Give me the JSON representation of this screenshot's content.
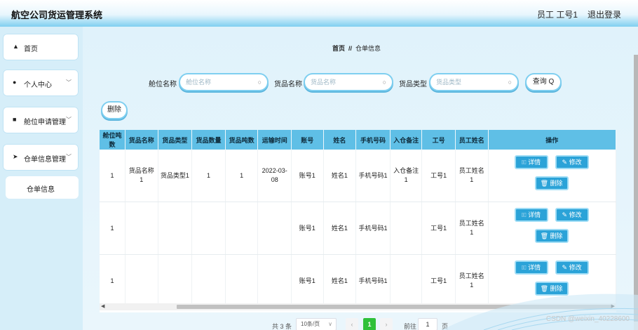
{
  "header": {
    "title": "航空公司货运管理系统",
    "user": "员工 工号1",
    "logout": "退出登录"
  },
  "sidebar": {
    "items": [
      {
        "label": "首页",
        "icon": "home-icon",
        "glyph": "▲"
      },
      {
        "label": "个人中心",
        "icon": "user-icon",
        "glyph": "●"
      },
      {
        "label": "舱位申请管理",
        "icon": "document-icon",
        "glyph": "■"
      },
      {
        "label": "仓单信息管理",
        "icon": "send-icon",
        "glyph": "➤"
      }
    ],
    "submenu": "仓单信息"
  },
  "breadcrumb": {
    "home": "首页",
    "sep": "//",
    "current": "仓单信息"
  },
  "search": {
    "f1_label": "舱位名称",
    "f1_placeholder": "舱位名称",
    "f2_label": "货品名称",
    "f2_placeholder": "货品名称",
    "f3_label": "货品类型",
    "f3_placeholder": "货品类型",
    "query": "查询 Q",
    "delete": "删除"
  },
  "table": {
    "headers": [
      "舱位吨数",
      "货品名称",
      "货品类型",
      "货品数量",
      "货品吨数",
      "运输时间",
      "账号",
      "姓名",
      "手机号码",
      "入仓备注",
      "工号",
      "员工姓名",
      "操作"
    ],
    "rows": [
      [
        "1",
        "货品名称1",
        "货品类型1",
        "1",
        "1",
        "2022-03-08",
        "账号1",
        "姓名1",
        "手机号码1",
        "入仓备注1",
        "工号1",
        "员工姓名1"
      ],
      [
        "1",
        "",
        "",
        "",
        "",
        "",
        "账号1",
        "姓名1",
        "手机号码1",
        "",
        "工号1",
        "员工姓名1"
      ],
      [
        "1",
        "",
        "",
        "",
        "",
        "",
        "账号1",
        "姓名1",
        "手机号码1",
        "",
        "工号1",
        "员工姓名1"
      ]
    ],
    "ops": {
      "detail": "🗉 详情",
      "edit": "✎ 修改",
      "delete": "🗑 删除"
    }
  },
  "pager": {
    "total": "共 3 条",
    "size": "10条/页",
    "page": "1",
    "goto": "前往",
    "goto_value": "1",
    "unit": "页"
  },
  "watermark": "CSDN @weixin_40228600",
  "colors": {
    "accent": "#2ba3d8",
    "header_bg": "#5fbfe6",
    "active_page": "#2ec13a"
  }
}
